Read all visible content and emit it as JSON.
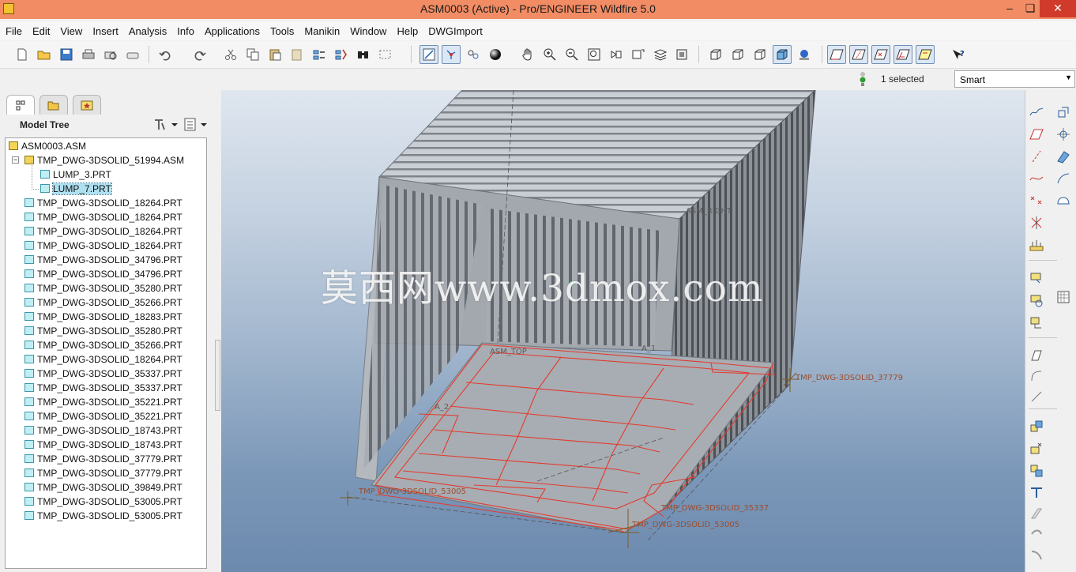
{
  "window": {
    "title": "ASM0003 (Active) - Pro/ENGINEER Wildfire 5.0",
    "minimize": "–",
    "maximize": "❏",
    "close": "✕"
  },
  "menu": [
    "File",
    "Edit",
    "View",
    "Insert",
    "Analysis",
    "Info",
    "Applications",
    "Tools",
    "Manikin",
    "Window",
    "Help",
    "DWGImport"
  ],
  "toolbar": {
    "icons": [
      "new-file-icon",
      "open-folder-icon",
      "save-icon",
      "print-icon",
      "print-preview-icon",
      "print-setup-icon",
      "undo-icon",
      "redo-icon",
      "cut-icon",
      "copy-icon",
      "paste-icon",
      "paste-special-icon",
      "regenerate-icon",
      "regenerate-manager-icon",
      "find-icon",
      "select-box-icon",
      "refit-icon",
      "spin-center-icon",
      "orient-mode-icon",
      "appearance-sphere-icon",
      "pan-icon",
      "zoom-in-icon",
      "zoom-out-icon",
      "zoom-fit-icon",
      "reorient-icon",
      "saved-views-icon",
      "layers-icon",
      "view-manager-icon",
      "wireframe-icon",
      "hidden-line-icon",
      "no-hidden-icon",
      "shading-icon",
      "enhanced-realism-icon",
      "datum-planes-icon",
      "datum-axes-icon",
      "datum-points-icon",
      "coordinate-systems-icon",
      "annotations-icon",
      "context-help-icon"
    ]
  },
  "selection": {
    "count_text": "1 selected",
    "filter_value": "Smart"
  },
  "left_panel": {
    "tabs": [
      "model-tree-tab",
      "folder-browser-tab",
      "favorites-tab"
    ],
    "header": "Model Tree",
    "tree": [
      {
        "label": "ASM0003.ASM",
        "type": "asm",
        "level": 0
      },
      {
        "label": "TMP_DWG-3DSOLID_51994.ASM",
        "type": "asm",
        "level": 1,
        "expanded": true
      },
      {
        "label": "LUMP_3.PRT",
        "type": "prt",
        "level": 2
      },
      {
        "label": "LUMP_7.PRT",
        "type": "prt",
        "level": 2,
        "selected": true
      },
      {
        "label": "TMP_DWG-3DSOLID_18264.PRT",
        "type": "prt",
        "level": 1
      },
      {
        "label": "TMP_DWG-3DSOLID_18264.PRT",
        "type": "prt",
        "level": 1
      },
      {
        "label": "TMP_DWG-3DSOLID_18264.PRT",
        "type": "prt",
        "level": 1
      },
      {
        "label": "TMP_DWG-3DSOLID_18264.PRT",
        "type": "prt",
        "level": 1
      },
      {
        "label": "TMP_DWG-3DSOLID_34796.PRT",
        "type": "prt",
        "level": 1
      },
      {
        "label": "TMP_DWG-3DSOLID_34796.PRT",
        "type": "prt",
        "level": 1
      },
      {
        "label": "TMP_DWG-3DSOLID_35280.PRT",
        "type": "prt",
        "level": 1
      },
      {
        "label": "TMP_DWG-3DSOLID_35266.PRT",
        "type": "prt",
        "level": 1
      },
      {
        "label": "TMP_DWG-3DSOLID_18283.PRT",
        "type": "prt",
        "level": 1
      },
      {
        "label": "TMP_DWG-3DSOLID_35280.PRT",
        "type": "prt",
        "level": 1
      },
      {
        "label": "TMP_DWG-3DSOLID_35266.PRT",
        "type": "prt",
        "level": 1
      },
      {
        "label": "TMP_DWG-3DSOLID_18264.PRT",
        "type": "prt",
        "level": 1
      },
      {
        "label": "TMP_DWG-3DSOLID_35337.PRT",
        "type": "prt",
        "level": 1
      },
      {
        "label": "TMP_DWG-3DSOLID_35337.PRT",
        "type": "prt",
        "level": 1
      },
      {
        "label": "TMP_DWG-3DSOLID_35221.PRT",
        "type": "prt",
        "level": 1
      },
      {
        "label": "TMP_DWG-3DSOLID_35221.PRT",
        "type": "prt",
        "level": 1
      },
      {
        "label": "TMP_DWG-3DSOLID_18743.PRT",
        "type": "prt",
        "level": 1
      },
      {
        "label": "TMP_DWG-3DSOLID_18743.PRT",
        "type": "prt",
        "level": 1
      },
      {
        "label": "TMP_DWG-3DSOLID_37779.PRT",
        "type": "prt",
        "level": 1
      },
      {
        "label": "TMP_DWG-3DSOLID_37779.PRT",
        "type": "prt",
        "level": 1
      },
      {
        "label": "TMP_DWG-3DSOLID_39849.PRT",
        "type": "prt",
        "level": 1
      },
      {
        "label": "TMP_DWG-3DSOLID_53005.PRT",
        "type": "prt",
        "level": 1
      },
      {
        "label": "TMP_DWG-3DSOLID_53005.PRT",
        "type": "prt",
        "level": 1
      }
    ]
  },
  "viewport": {
    "watermark": "莫西网www.3dmox.com",
    "datum_labels": {
      "asm_right": "ASM_RIGHT",
      "asm_top": "ASM_TOP",
      "a1": "A_1",
      "a2": "A_2",
      "csys_37779": "TMP_DWG-3DSOLID_37779",
      "csys_53005_left": "TMP_DWG-3DSOLID_53005",
      "csys_35337": "TMP_DWG-3DSOLID_35337",
      "csys_53005_right": "TMP_DWG-3DSOLID_53005"
    },
    "colors": {
      "wireframe": "#e33b2e",
      "body": "#9aa0a7",
      "background_top": "#dfe6ef",
      "background_bottom": "#6c8aae"
    }
  },
  "right_toolbar": {
    "icons": [
      "sketch-tool-icon",
      "datum-plane-icon",
      "datum-axis-icon",
      "datum-curve-icon",
      "datum-point-icon",
      "datum-csys-icon",
      "analysis-feature-icon",
      "extrude-icon",
      "revolve-icon",
      "sweep-icon",
      "blend-icon",
      "hole-icon",
      "round-icon",
      "chamfer-icon",
      "draft-icon",
      "pattern-icon",
      "mirror-icon",
      "merge-icon",
      "trim-icon",
      "intersect-icon",
      "assemble-icon",
      "create-component-icon",
      "package-icon",
      "drag-component-icon",
      "shell-icon",
      "rib-icon"
    ]
  }
}
